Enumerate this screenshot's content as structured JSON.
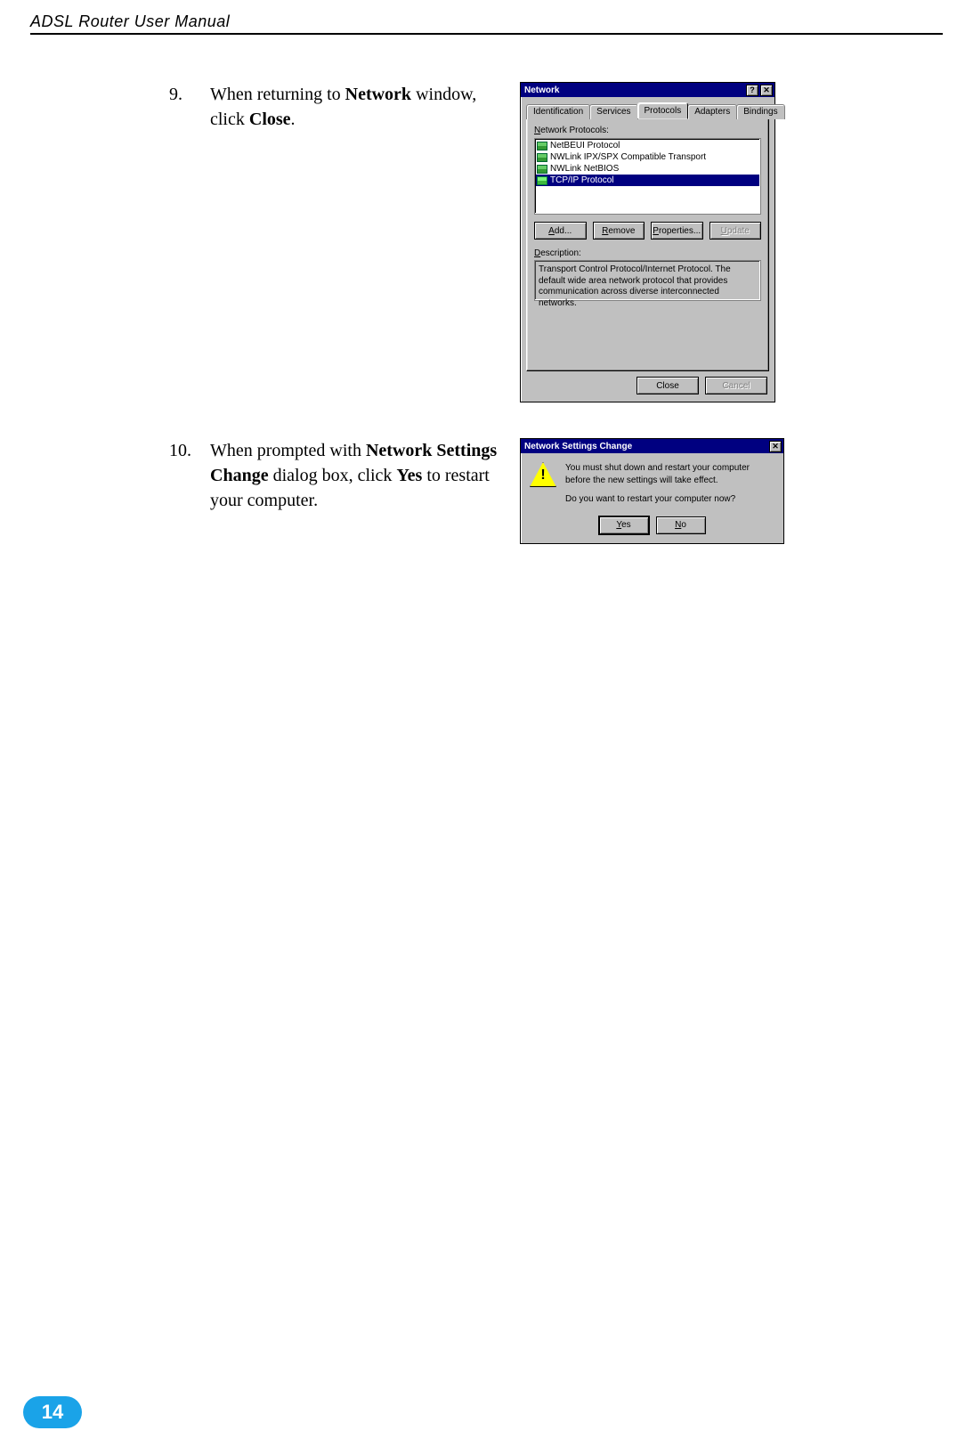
{
  "page_header": "ADSL Router User Manual",
  "page_number": "14",
  "steps": {
    "s9": {
      "num": "9.",
      "pre": "When returning to ",
      "bold1": "Network",
      "mid": " window, click ",
      "bold2": "Close",
      "post": "."
    },
    "s10": {
      "num": "10.",
      "pre": "When prompted with ",
      "bold1": "Network Settings Change",
      "mid": " dialog box, click ",
      "bold2": "Yes",
      "post": " to restart your computer."
    }
  },
  "net_dialog": {
    "title": "Network",
    "help_btn": "?",
    "close_btn": "✕",
    "tabs": {
      "identification": "Identification",
      "services": "Services",
      "protocols": "Protocols",
      "adapters": "Adapters",
      "bindings": "Bindings"
    },
    "list_label_u": "N",
    "list_label_rest": "etwork Protocols:",
    "items": [
      "NetBEUI Protocol",
      "NWLink IPX/SPX Compatible Transport",
      "NWLink NetBIOS",
      "TCP/IP Protocol"
    ],
    "buttons": {
      "add_u": "A",
      "add_rest": "dd...",
      "remove_u": "R",
      "remove_rest": "emove",
      "props_u": "P",
      "props_rest": "roperties...",
      "update_u": "U",
      "update_rest": "pdate"
    },
    "desc_label_u": "D",
    "desc_label_rest": "escription:",
    "desc_text": "Transport Control Protocol/Internet Protocol. The default wide area network protocol that provides communication across diverse interconnected networks.",
    "close": "Close",
    "cancel": "Cancel"
  },
  "msg_dialog": {
    "title": "Network Settings Change",
    "close_btn": "✕",
    "line1": "You must shut down and restart your computer before the new settings will take effect.",
    "line2": "Do you want to restart your computer now?",
    "yes_u": "Y",
    "yes_rest": "es",
    "no_u": "N",
    "no_rest": "o"
  }
}
